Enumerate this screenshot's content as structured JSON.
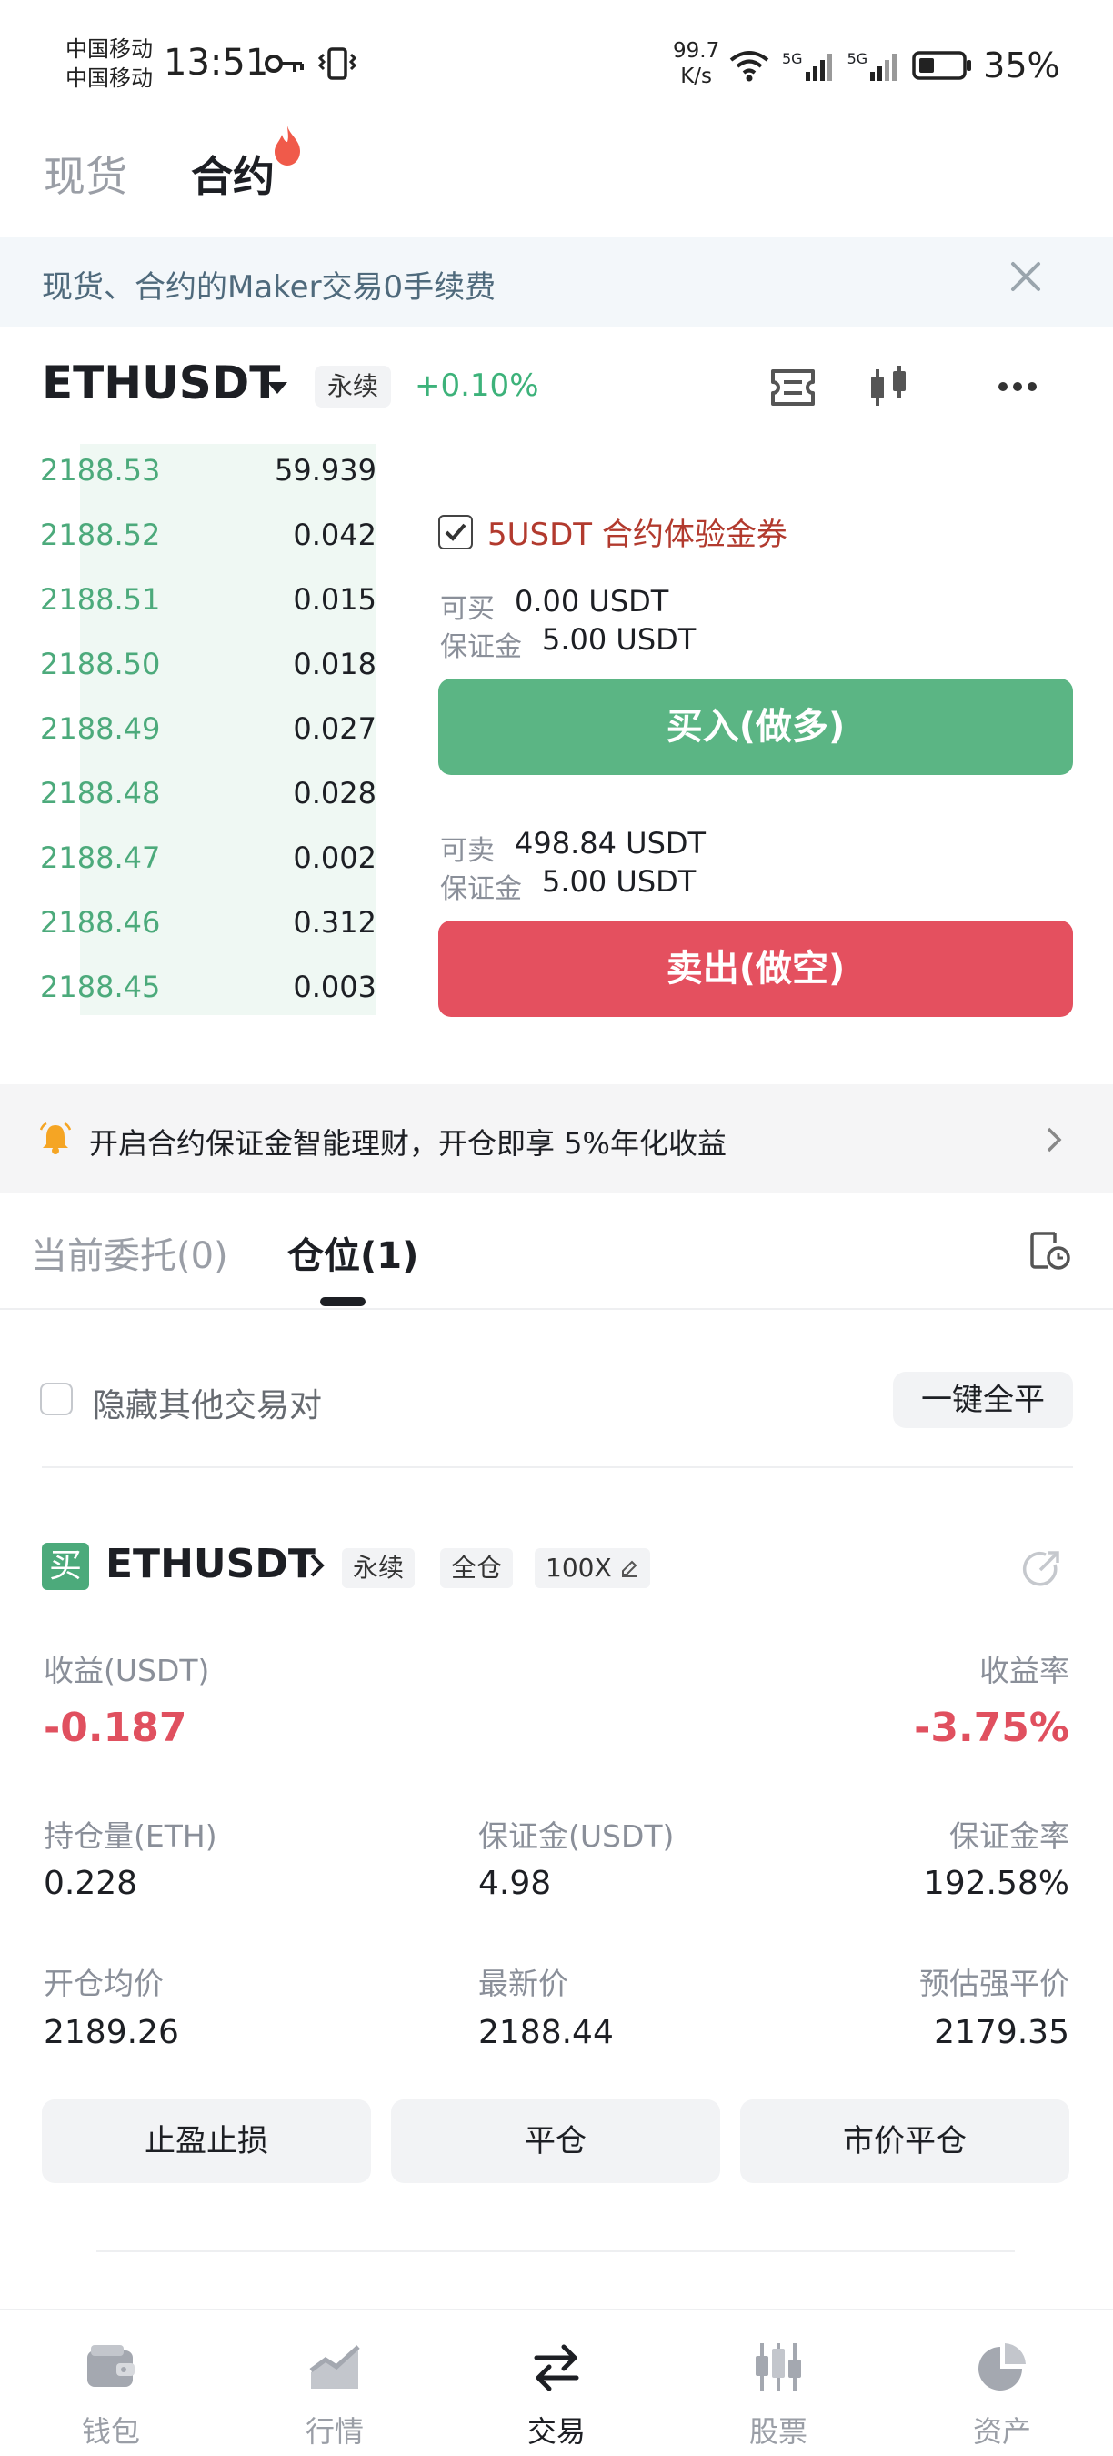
{
  "status_bar": {
    "carrier1": "中国移动",
    "carrier2": "中国移动",
    "time": "13:51",
    "net_speed_value": "99.7",
    "net_speed_unit": "K/s",
    "signal1": "5G",
    "signal2": "5G",
    "battery": "35%"
  },
  "top_tabs": {
    "spot": "现货",
    "contract": "合约"
  },
  "banner": {
    "text": "现货、合约的Maker交易0手续费"
  },
  "header": {
    "symbol": "ETHUSDT",
    "perpetual_tag": "永续",
    "change": "+0.10%"
  },
  "order_book": [
    {
      "price": "2188.53",
      "qty": "59.939"
    },
    {
      "price": "2188.52",
      "qty": "0.042"
    },
    {
      "price": "2188.51",
      "qty": "0.015"
    },
    {
      "price": "2188.50",
      "qty": "0.018"
    },
    {
      "price": "2188.49",
      "qty": "0.027"
    },
    {
      "price": "2188.48",
      "qty": "0.028"
    },
    {
      "price": "2188.47",
      "qty": "0.002"
    },
    {
      "price": "2188.46",
      "qty": "0.312"
    },
    {
      "price": "2188.45",
      "qty": "0.003"
    }
  ],
  "trade_panel": {
    "coupon": "5USDT 合约体验金券",
    "buy_avail_label": "可买",
    "buy_avail_value": "0.00 USDT",
    "buy_margin_label": "保证金",
    "buy_margin_value": "5.00 USDT",
    "buy_button": "买入(做多)",
    "sell_avail_label": "可卖",
    "sell_avail_value": "498.84 USDT",
    "sell_margin_label": "保证金",
    "sell_margin_value": "5.00 USDT",
    "sell_button": "卖出(做空)"
  },
  "promo": {
    "text": "开启合约保证金智能理财，开仓即享 5%年化收益"
  },
  "sub_tabs": {
    "orders": "当前委托(0)",
    "positions": "仓位(1)"
  },
  "filter": {
    "hide_label": "隐藏其他交易对",
    "close_all": "一键全平"
  },
  "position": {
    "side_badge": "买",
    "symbol": "ETHUSDT",
    "tag_perpetual": "永续",
    "tag_cross": "全仓",
    "tag_leverage": "100X",
    "pnl_label": "收益(USDT)",
    "pnl_value": "-0.187",
    "pnl_rate_label": "收益率",
    "pnl_rate_value": "-3.75%",
    "size_label": "持仓量(ETH)",
    "size_value": "0.228",
    "margin_label": "保证金(USDT)",
    "margin_value": "4.98",
    "margin_rate_label": "保证金率",
    "margin_rate_value": "192.58%",
    "entry_label": "开仓均价",
    "entry_value": "2189.26",
    "last_label": "最新价",
    "last_value": "2188.44",
    "liq_label": "预估强平价",
    "liq_value": "2179.35",
    "btn_tpsl": "止盈止损",
    "btn_close": "平仓",
    "btn_market_close": "市价平仓"
  },
  "bottom_nav": {
    "wallet": "钱包",
    "market": "行情",
    "trade": "交易",
    "stocks": "股票",
    "assets": "资产"
  },
  "colors": {
    "green": "#5bb584",
    "red": "#e4505f",
    "text": "#1d1f24"
  }
}
